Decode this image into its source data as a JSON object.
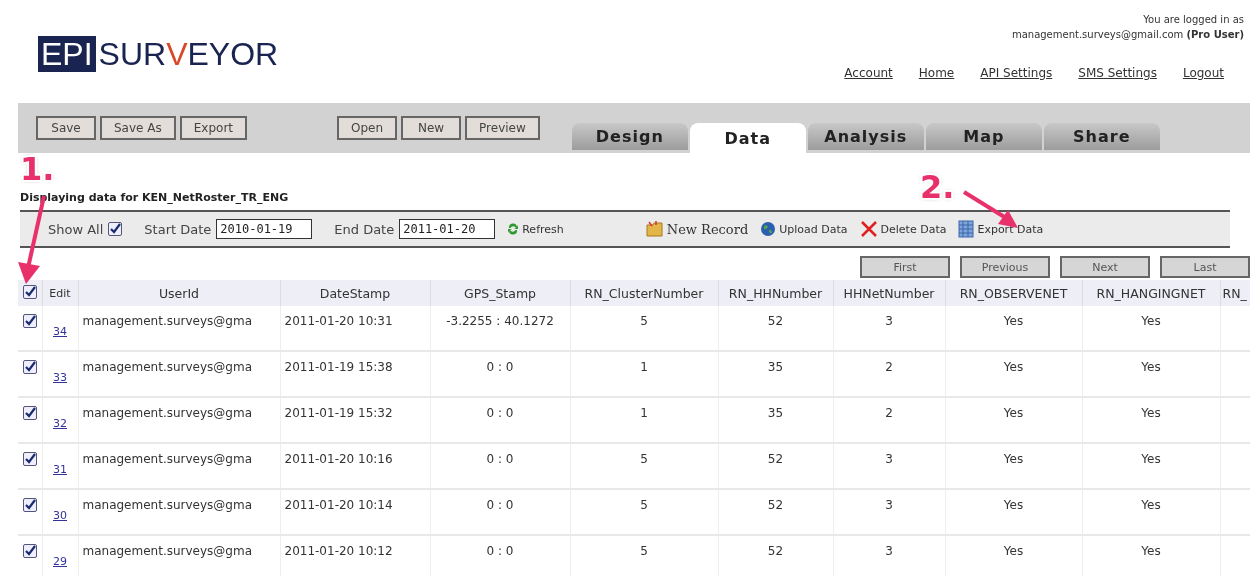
{
  "logo": {
    "parts": [
      {
        "text": "EPI",
        "kind": "boxed"
      },
      {
        "text": "SUR",
        "kind": "plain"
      },
      {
        "text": "V",
        "kind": "accent"
      },
      {
        "text": "EYOR",
        "kind": "plain"
      }
    ]
  },
  "login": {
    "line1": "You are logged in as",
    "email": "management.surveys@gmail.com",
    "role": "(Pro User)"
  },
  "nav_links": [
    "Account",
    "Home",
    "API Settings",
    "SMS Settings",
    "Logout"
  ],
  "toolbar": {
    "left_buttons": [
      "Save",
      "Save As",
      "Export"
    ],
    "right_buttons": [
      "Open",
      "New",
      "Preview"
    ]
  },
  "tabs": [
    {
      "label": "Design",
      "selected": false
    },
    {
      "label": "Data",
      "selected": true
    },
    {
      "label": "Analysis",
      "selected": false
    },
    {
      "label": "Map",
      "selected": false
    },
    {
      "label": "Share",
      "selected": false
    }
  ],
  "heading": "Displaying data for KEN_NetRoster_TR_ENG",
  "filter_bar": {
    "show_all": {
      "label": "Show All",
      "checked": true
    },
    "start_date": {
      "label": "Start Date",
      "value": "2010-01-19"
    },
    "end_date": {
      "label": "End Date",
      "value": "2011-01-20"
    },
    "actions": [
      {
        "label": "Refresh",
        "kind": "refresh"
      },
      {
        "label": "New Record",
        "kind": "new"
      },
      {
        "label": "Upload Data",
        "kind": "upload"
      },
      {
        "label": "Delete Data",
        "kind": "delete"
      },
      {
        "label": "Export Data",
        "kind": "export"
      }
    ]
  },
  "pagination": [
    {
      "label": "First",
      "disabled": true
    },
    {
      "label": "Previous",
      "disabled": true
    },
    {
      "label": "Next",
      "disabled": true
    },
    {
      "label": "Last",
      "disabled": true
    }
  ],
  "table": {
    "select_all_checked": true,
    "columns": [
      "Edit",
      "UserId",
      "DateStamp",
      "GPS_Stamp",
      "RN_ClusterNumber",
      "RN_HHNumber",
      "HHNetNumber",
      "RN_OBSERVENET",
      "RN_HANGINGNET",
      "RN_"
    ],
    "rows": [
      {
        "checked": true,
        "cells": [
          "34",
          "management.surveys@gma",
          "2011-01-20 10:31",
          "-3.2255 : 40.1272",
          "5",
          "52",
          "3",
          "Yes",
          "Yes"
        ]
      },
      {
        "checked": true,
        "cells": [
          "33",
          "management.surveys@gma",
          "2011-01-19 15:38",
          "0 : 0",
          "1",
          "35",
          "2",
          "Yes",
          "Yes"
        ]
      },
      {
        "checked": true,
        "cells": [
          "32",
          "management.surveys@gma",
          "2011-01-19 15:32",
          "0 : 0",
          "1",
          "35",
          "2",
          "Yes",
          "Yes"
        ]
      },
      {
        "checked": true,
        "cells": [
          "31",
          "management.surveys@gma",
          "2011-01-20 10:16",
          "0 : 0",
          "5",
          "52",
          "3",
          "Yes",
          "Yes"
        ]
      },
      {
        "checked": true,
        "cells": [
          "30",
          "management.surveys@gma",
          "2011-01-20 10:14",
          "0 : 0",
          "5",
          "52",
          "3",
          "Yes",
          "Yes"
        ]
      },
      {
        "checked": true,
        "cells": [
          "29",
          "management.surveys@gma",
          "2011-01-20 10:12",
          "0 : 0",
          "5",
          "52",
          "3",
          "Yes",
          "Yes"
        ]
      }
    ]
  },
  "annotations": [
    {
      "label": "1."
    },
    {
      "label": "2."
    }
  ]
}
